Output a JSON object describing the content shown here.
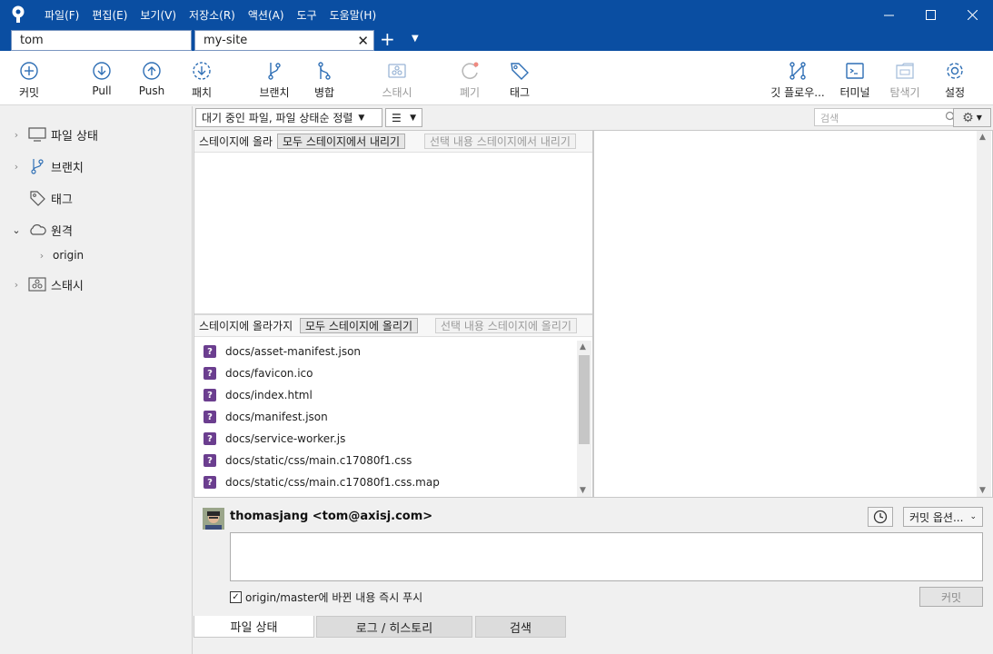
{
  "menu": [
    "파일(F)",
    "편집(E)",
    "보기(V)",
    "저장소(R)",
    "액션(A)",
    "도구",
    "도움말(H)"
  ],
  "tabs": [
    {
      "label": "tom"
    },
    {
      "label": "my-site"
    }
  ],
  "toolbar": {
    "commit": "커밋",
    "pull": "Pull",
    "push": "Push",
    "fetch": "패치",
    "branch": "브랜치",
    "merge": "병합",
    "stash": "스태시",
    "discard": "폐기",
    "tag": "태그",
    "gitflow": "깃 플로우...",
    "terminal": "터미널",
    "explorer": "탐색기",
    "settings": "설정"
  },
  "sidebar": {
    "file_status": "파일 상태",
    "branches": "브랜치",
    "tags": "태그",
    "remotes": "원격",
    "origin": "origin",
    "stashes": "스태시"
  },
  "filter": {
    "sort_label": "대기 중인 파일, 파일 상태순 정렬",
    "search_placeholder": "검색"
  },
  "staged": {
    "label": "스테이지에 올라",
    "unstage_all": "모두 스테이지에서 내리기",
    "unstage_selected": "선택 내용 스테이지에서 내리기"
  },
  "unstaged": {
    "label": "스테이지에 올라가지",
    "stage_all": "모두 스테이지에 올리기",
    "stage_selected": "선택 내용 스테이지에 올리기",
    "files": [
      "docs/asset-manifest.json",
      "docs/favicon.ico",
      "docs/index.html",
      "docs/manifest.json",
      "docs/service-worker.js",
      "docs/static/css/main.c17080f1.css",
      "docs/static/css/main.c17080f1.css.map"
    ]
  },
  "commit_area": {
    "author": "thomasjang <tom@axisj.com>",
    "options": "커밋 옵션...",
    "push_label": "origin/master에 바뀐 내용 즉시 푸시",
    "commit_button": "커밋"
  },
  "bottom_tabs": [
    "파일 상태",
    "로그 / 히스토리",
    "검색"
  ],
  "colors": {
    "titlebar": "#0a4ea2",
    "toolbar_icon": "#2f6fb5",
    "untracked_icon": "#6b3e8f"
  }
}
